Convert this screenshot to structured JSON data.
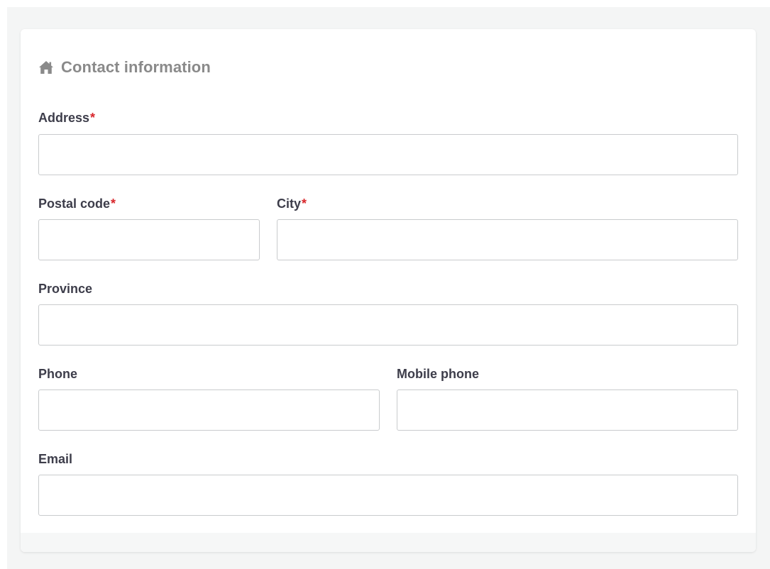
{
  "section": {
    "title": "Contact information",
    "icon": "home-icon"
  },
  "fields": {
    "address": {
      "label": "Address",
      "required_mark": "*",
      "value": ""
    },
    "postal_code": {
      "label": "Postal code",
      "required_mark": "*",
      "value": ""
    },
    "city": {
      "label": "City",
      "required_mark": "*",
      "value": ""
    },
    "province": {
      "label": "Province",
      "value": ""
    },
    "phone": {
      "label": "Phone",
      "value": ""
    },
    "mobile_phone": {
      "label": "Mobile phone",
      "value": ""
    },
    "email": {
      "label": "Email",
      "value": ""
    }
  },
  "colors": {
    "required": "#d8262b",
    "title": "#8a8a8a",
    "label": "#3d3d4a"
  }
}
